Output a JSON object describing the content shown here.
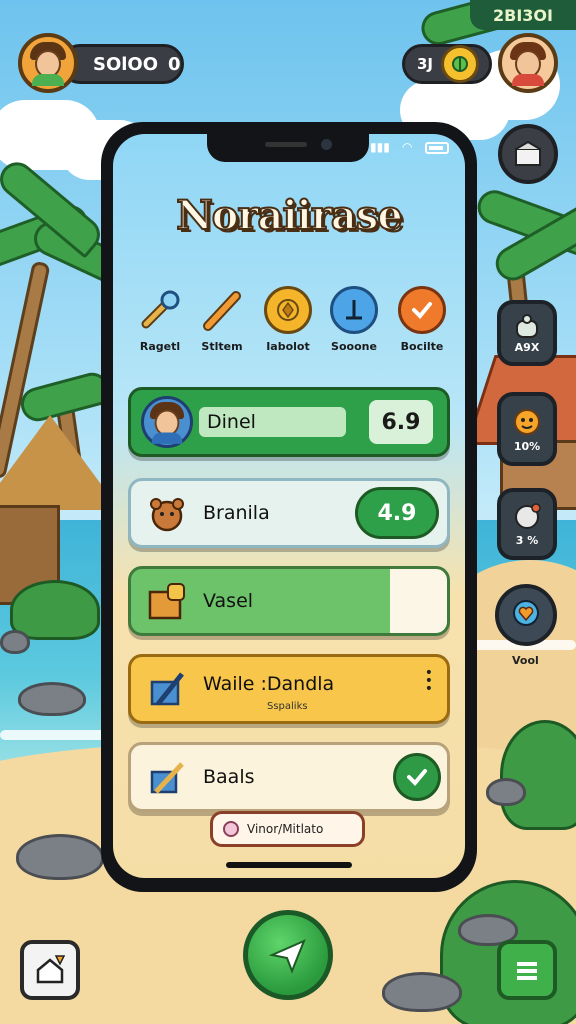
{
  "hud": {
    "score_value": "SOlOO",
    "score_extra": "0",
    "coins_top": "2BI3OI",
    "friend_count": "3J"
  },
  "app": {
    "title": "Noraiirase"
  },
  "tools": [
    {
      "label": "Ragetl",
      "icon": "magnifier-wand-icon",
      "color": "#3f8fd0"
    },
    {
      "label": "Stltem",
      "icon": "stick-icon",
      "color": "#f19a34"
    },
    {
      "label": "Iabolot",
      "icon": "shell-coin-icon",
      "color": "#f4b52a"
    },
    {
      "label": "Sooone",
      "icon": "pin-icon",
      "color": "#4da4e6"
    },
    {
      "label": "Bocilte",
      "icon": "check-badge-icon",
      "color": "#f07a2c"
    }
  ],
  "cards": [
    {
      "name": "Dinel",
      "value": "6.9",
      "color": "#2fa04a"
    },
    {
      "name": "Branila",
      "value": "4.9",
      "color": "#e8f3e6"
    },
    {
      "name": "Vasel",
      "color": "#6cc36a"
    },
    {
      "name": "Waile :Dandla",
      "subtitle": "Sspaliks",
      "color": "#f7c64a"
    },
    {
      "name": "Baals",
      "color": "#fbf3dc"
    }
  ],
  "footer": {
    "pill_label": "Vinor/Mitlato"
  },
  "side_widgets": [
    {
      "label": "A9X",
      "icon": "bag-icon"
    },
    {
      "label": "10%",
      "icon": "sun-face-icon"
    },
    {
      "label": "3 %",
      "icon": "compass-icon"
    },
    {
      "label": "Vool",
      "icon": "heart-pin-icon"
    }
  ],
  "colors": {
    "accent_green": "#2fa04a",
    "brand_brown": "#4a2e14",
    "gold": "#f7c64a"
  }
}
